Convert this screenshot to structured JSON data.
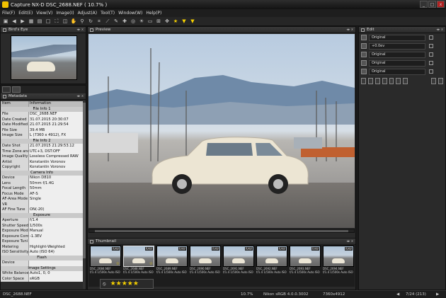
{
  "window": {
    "title": "Capture NX-D   DSC_2688.NEF ( 10.7% )",
    "minimize": "_",
    "maximize": "□",
    "close": "x"
  },
  "menu": [
    "File(F)",
    "Edit(E)",
    "View(V)",
    "Image(I)",
    "Adjust(A)",
    "Tool(T)",
    "Window(W)",
    "Help(P)"
  ],
  "panels": {
    "birdseye": "Bird's Eye",
    "metadata": "Metadata",
    "preview": "Preview",
    "thumbnail": "Thumbnail",
    "edit": "Edit"
  },
  "metadata": {
    "header": {
      "item": "Item",
      "info": "Information"
    },
    "rows": [
      {
        "type": "section",
        "label": "File Info 1"
      },
      {
        "k": "File",
        "v": "DSC_2688.NEF"
      },
      {
        "k": "Date Created",
        "v": "31.07.2015 20:30:07"
      },
      {
        "k": "Date Modified",
        "v": "21.07.2015 21:29:54"
      },
      {
        "k": "File Size",
        "v": "39.4 MB"
      },
      {
        "k": "Image Size",
        "v": "L (7360 x 4912), FX"
      },
      {
        "type": "section",
        "label": "File Info 2"
      },
      {
        "k": "Date Shot",
        "v": "21.07.2015 21:29:53.12"
      },
      {
        "k": "Time Zone and",
        "v": "UTC+3, DST:OFF"
      },
      {
        "k": "Image Quality",
        "v": "Lossless Compressed RAW"
      },
      {
        "k": "Artist",
        "v": "Konstantin Voronov"
      },
      {
        "k": "Copyright",
        "v": "Konstantin Voronov"
      },
      {
        "type": "section",
        "label": "Camera Info"
      },
      {
        "k": "Device",
        "v": "Nikon D810"
      },
      {
        "k": "Lens",
        "v": "50mm f/1.4G"
      },
      {
        "k": "Focal Length",
        "v": "50mm"
      },
      {
        "k": "Focus Mode",
        "v": "AF-S"
      },
      {
        "k": "AF-Area Mode",
        "v": "Single"
      },
      {
        "k": "VR",
        "v": ""
      },
      {
        "k": "AF Fine Tune",
        "v": "ON(-20)"
      },
      {
        "type": "section",
        "label": "Exposure"
      },
      {
        "k": "Aperture",
        "v": "f/1.4"
      },
      {
        "k": "Shutter Speed",
        "v": "1/500s"
      },
      {
        "k": "Exposure Mode",
        "v": "Manual"
      },
      {
        "k": "Exposure Com",
        "v": "-1.3EV"
      },
      {
        "k": "Exposure Tuni",
        "v": ""
      },
      {
        "k": "Metering",
        "v": "Highlight-Weighted"
      },
      {
        "k": "ISO Sensitivity",
        "v": "Auto (ISO 64)"
      },
      {
        "type": "section",
        "label": "Flash"
      },
      {
        "k": "Device",
        "v": ""
      },
      {
        "type": "section",
        "label": "Image Settings"
      },
      {
        "k": "White Balance",
        "v": "Auto1, 0, 0"
      },
      {
        "k": "Color Space",
        "v": "sRGB"
      }
    ]
  },
  "edit": {
    "rows": [
      {
        "value": "Original"
      },
      {
        "value": "+0.0ev"
      },
      {
        "value": "Original"
      },
      {
        "value": "Original"
      },
      {
        "value": "Original"
      }
    ]
  },
  "thumbnails": [
    {
      "name": "DSC_2684.NEF",
      "info": "f/1.4 1/500s Auto ISO 64",
      "raw": "RAW",
      "star": true
    },
    {
      "name": "DSC_2688.NEF",
      "info": "f/1.4 1/500s Auto ISO 64",
      "raw": "RAW",
      "star": true,
      "selected": true
    },
    {
      "name": "DSC_2689.NEF",
      "info": "f/1.4 1/500s Auto ISO 64",
      "raw": "RAW",
      "star": false
    },
    {
      "name": "DSC_2690.NEF",
      "info": "f/1.4 1/500s Auto ISO 64",
      "raw": "RAW",
      "star": false
    },
    {
      "name": "DSC_2691.NEF",
      "info": "f/1.4 1/500s Auto ISO 64",
      "raw": "RAW",
      "star": false
    },
    {
      "name": "DSC_2692.NEF",
      "info": "f/1.4 1/500s Auto ISO 64",
      "raw": "RAW",
      "star": false
    },
    {
      "name": "DSC_2693.NEF",
      "info": "f/1.4 1/500s Auto ISO 64",
      "raw": "RAW",
      "star": false
    },
    {
      "name": "DSC_2694.NEF",
      "info": "f/1.4 1/500s Auto ISO 64",
      "raw": "RAW",
      "star": false
    }
  ],
  "rating": {
    "none": "⦸",
    "stars": "★★★★★"
  },
  "status": {
    "file": "DSC_2688.NEF",
    "zoom": "10.7%",
    "profile": "Nikon sRGB 4.0.0.3002",
    "dims": "7360x4912",
    "pager": "7/24 (213)"
  }
}
